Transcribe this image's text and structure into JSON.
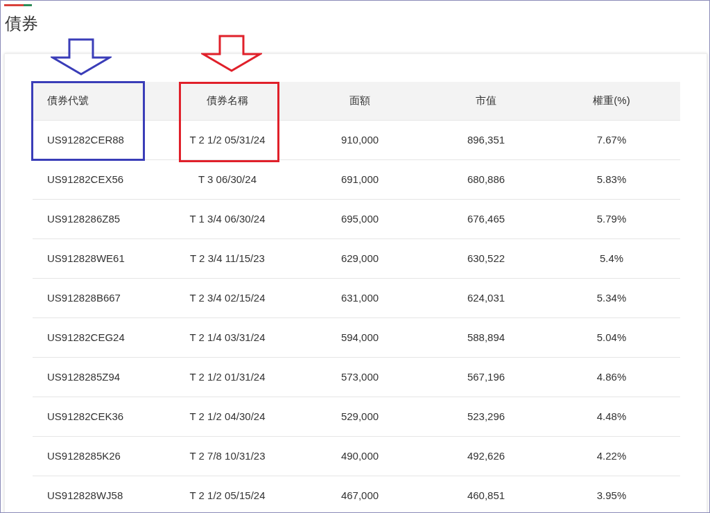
{
  "title": "債券",
  "table": {
    "columns": [
      "債券代號",
      "債券名稱",
      "面額",
      "市值",
      "權重(%)"
    ],
    "rows": [
      [
        "US91282CER88",
        "T 2 1/2 05/31/24",
        "910,000",
        "896,351",
        "7.67%"
      ],
      [
        "US91282CEX56",
        "T 3 06/30/24",
        "691,000",
        "680,886",
        "5.83%"
      ],
      [
        "US9128286Z85",
        "T 1 3/4 06/30/24",
        "695,000",
        "676,465",
        "5.79%"
      ],
      [
        "US912828WE61",
        "T 2 3/4 11/15/23",
        "629,000",
        "630,522",
        "5.4%"
      ],
      [
        "US912828B667",
        "T 2 3/4 02/15/24",
        "631,000",
        "624,031",
        "5.34%"
      ],
      [
        "US91282CEG24",
        "T 2 1/4 03/31/24",
        "594,000",
        "588,894",
        "5.04%"
      ],
      [
        "US9128285Z94",
        "T 2 1/2 01/31/24",
        "573,000",
        "567,196",
        "4.86%"
      ],
      [
        "US91282CEK36",
        "T 2 1/2 04/30/24",
        "529,000",
        "523,296",
        "4.48%"
      ],
      [
        "US9128285K26",
        "T 2 7/8 10/31/23",
        "490,000",
        "492,626",
        "4.22%"
      ],
      [
        "US912828WJ58",
        "T 2 1/2 05/15/24",
        "467,000",
        "460,851",
        "3.95%"
      ]
    ]
  },
  "annotations": [
    {
      "color": "#3a3db8"
    },
    {
      "color": "#e0202a"
    }
  ]
}
